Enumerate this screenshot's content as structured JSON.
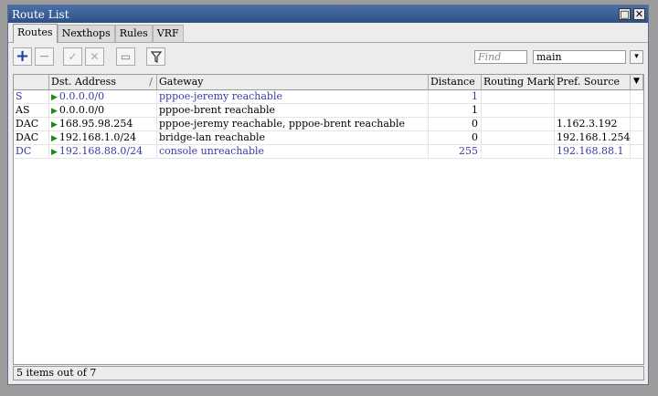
{
  "window": {
    "title": "Route List"
  },
  "tabs": [
    "Routes",
    "Nexthops",
    "Rules",
    "VRF"
  ],
  "toolbar": {
    "find_placeholder": "Find",
    "table_selector": "main"
  },
  "columns": [
    "",
    "Dst. Address",
    "Gateway",
    "Distance",
    "Routing Mark",
    "Pref. Source"
  ],
  "rows": [
    {
      "flags": "S",
      "dst": "0.0.0.0/0",
      "gateway": "pppoe-jeremy reachable",
      "distance": "1",
      "mark": "",
      "pref": ""
    },
    {
      "flags": "AS",
      "dst": "0.0.0.0/0",
      "gateway": "pppoe-brent reachable",
      "distance": "1",
      "mark": "",
      "pref": ""
    },
    {
      "flags": "DAC",
      "dst": "168.95.98.254",
      "gateway": "pppoe-jeremy reachable, pppoe-brent reachable",
      "distance": "0",
      "mark": "",
      "pref": "1.162.3.192"
    },
    {
      "flags": "DAC",
      "dst": "192.168.1.0/24",
      "gateway": "bridge-lan reachable",
      "distance": "0",
      "mark": "",
      "pref": "192.168.1.254"
    },
    {
      "flags": "DC",
      "dst": "192.168.88.0/24",
      "gateway": "console unreachable",
      "distance": "255",
      "mark": "",
      "pref": "192.168.88.1"
    }
  ],
  "status": "5 items out of 7"
}
